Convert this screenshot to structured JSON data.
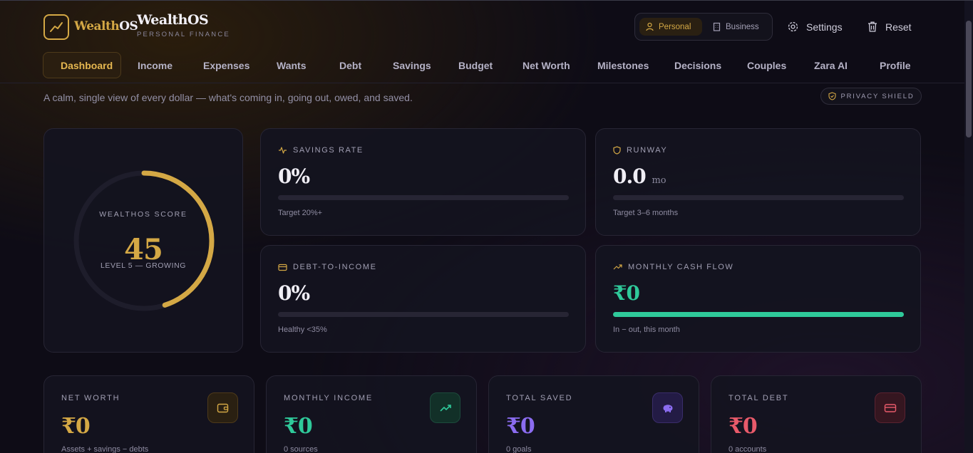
{
  "brand": {
    "logo_text_a": "Wealth",
    "logo_text_b": "OS",
    "title": "WealthOS",
    "subtitle": "PERSONAL FINANCE"
  },
  "mode": {
    "personal": "Personal",
    "business": "Business",
    "selected": "Personal"
  },
  "header_actions": {
    "settings": "Settings",
    "reset": "Reset"
  },
  "nav": {
    "active": "Dashboard",
    "items": [
      "Dashboard",
      "Income",
      "Expenses",
      "Wants",
      "Debt",
      "Savings",
      "Budget",
      "Net Worth",
      "Milestones",
      "Decisions",
      "Couples",
      "Zara AI",
      "Profile"
    ]
  },
  "tagline": "A calm, single view of every dollar — what's coming in, going out, owed, and saved.",
  "privacy_badge": "PRIVACY SHIELD",
  "score": {
    "label": "WEALTHOS SCORE",
    "value": "45",
    "level": "LEVEL 5 — GROWING",
    "progress": 0.45,
    "color": "#d4a845"
  },
  "metrics": {
    "savings_rate": {
      "label": "SAVINGS RATE",
      "value": "0%",
      "progress": 0,
      "note": "Target 20%+",
      "icon": "activity-icon"
    },
    "runway": {
      "label": "RUNWAY",
      "value": "0.0",
      "unit": "mo",
      "progress": 0,
      "note": "Target 3–6 months",
      "icon": "shield-icon"
    },
    "debt_to_income": {
      "label": "DEBT-TO-INCOME",
      "value": "0%",
      "progress": 0,
      "note": "Healthy <35%",
      "icon": "card-icon"
    },
    "monthly_cash_flow": {
      "label": "MONTHLY CASH FLOW",
      "value": "₹0",
      "progress": 1,
      "note": "In − out, this month",
      "icon": "trending-up-icon",
      "color": "#2fc99a"
    }
  },
  "stats": {
    "net_worth": {
      "label": "NET WORTH",
      "value": "₹0",
      "sub": "Assets + savings − debts",
      "icon": "wallet-icon",
      "color": "#d4a845"
    },
    "monthly_income": {
      "label": "MONTHLY INCOME",
      "value": "₹0",
      "sub": "0 sources",
      "icon": "trending-up-icon",
      "color": "#2fc99a"
    },
    "total_saved": {
      "label": "TOTAL SAVED",
      "value": "₹0",
      "sub": "0 goals",
      "icon": "piggy-bank-icon",
      "color": "#8b6cf0"
    },
    "total_debt": {
      "label": "TOTAL DEBT",
      "value": "₹0",
      "sub": "0 accounts",
      "icon": "card-icon",
      "color": "#e85a6a"
    }
  },
  "colors": {
    "accent": "#d4a845",
    "green": "#2fc99a",
    "purple": "#8b6cf0",
    "red": "#e85a6a",
    "background": "#0e0c16"
  }
}
